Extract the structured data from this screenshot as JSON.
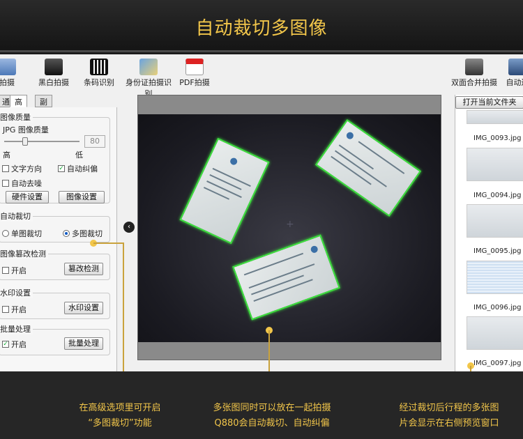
{
  "banner": {
    "title": "自动裁切多图像"
  },
  "toolbar": {
    "color_capture": "拍摄",
    "bw_capture": "黑白拍摄",
    "barcode": "条码识别",
    "id_card": "身份证拍摄识别",
    "pdf": "PDF拍摄",
    "duplex_merge": "双面合并拍摄",
    "auto_right": "自动连"
  },
  "tabs": [
    "通",
    "高级",
    "副摄像头"
  ],
  "image_quality": {
    "group": "图像质量",
    "format_label": "JPG 图像质量",
    "high": "高",
    "low": "低",
    "value": "80"
  },
  "options": {
    "text_direction": "文字方向",
    "text_direction_checked": false,
    "auto_deskew": "自动纠偏",
    "auto_deskew_checked": true,
    "auto_denoise": "自动去噪",
    "auto_denoise_checked": false
  },
  "buttons": {
    "hardware": "硬件设置",
    "image": "图像设置"
  },
  "crop": {
    "group": "自动裁切",
    "single": "单图裁切",
    "multi": "多图裁切",
    "selected": "multi"
  },
  "tamper": {
    "group": "图像篡改检测",
    "enable": "开启",
    "checked": false,
    "button": "篡改检测"
  },
  "watermark": {
    "group": "水印设置",
    "enable": "开启",
    "checked": false,
    "button": "水印设置"
  },
  "batch": {
    "group": "批量处理",
    "enable": "开启",
    "checked": true,
    "button": "批量处理"
  },
  "right_panel": {
    "open_folder": "打开当前文件夹",
    "files": [
      "IMG_0093.jpg",
      "IMG_0094.jpg",
      "IMG_0095.jpg",
      "IMG_0096.jpg",
      "IMG_0097.jpg"
    ]
  },
  "callouts": {
    "left": [
      "在高级选项里可开启",
      "“多图裁切”功能"
    ],
    "middle": [
      "多张图同时可以放在一起拍摄",
      "Q880会自动裁切、自动纠偏"
    ],
    "right": [
      "经过裁切后行程的多张图",
      "片会显示在右侧预览窗口"
    ]
  },
  "colors": {
    "accent": "#f2c64a",
    "crop_border": "#3ee03e"
  }
}
